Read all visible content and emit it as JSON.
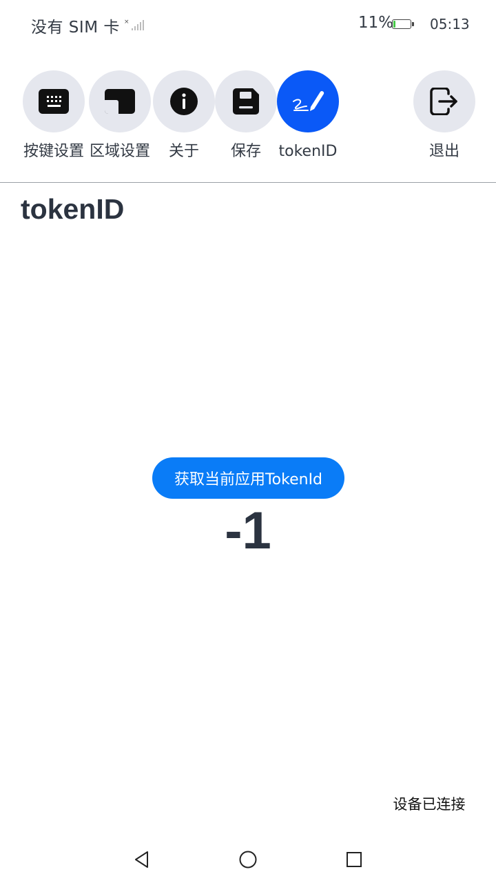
{
  "status_bar": {
    "carrier": "没有 SIM 卡",
    "battery_percent": "11%",
    "battery_level": 0.11,
    "battery_color": "#45c946",
    "time": "05:13",
    "signal_icon": "no-signal-icon"
  },
  "toolbar": {
    "items": [
      {
        "label": "按键设置",
        "icon": "keyboard-icon"
      },
      {
        "label": "区域设置",
        "icon": "region-icon"
      },
      {
        "label": "关于",
        "icon": "info-icon"
      },
      {
        "label": "保存",
        "icon": "save-icon"
      },
      {
        "label": "tokenID",
        "icon": "signature-pen-icon",
        "active": true
      },
      {
        "label": "退出",
        "icon": "exit-icon"
      }
    ],
    "active_color": "#0a59f7"
  },
  "main": {
    "title": "tokenID",
    "get_token_button": "获取当前应用TokenId",
    "token_value": "-1",
    "button_color": "#0a7cf7"
  },
  "footer": {
    "connection_status": "设备已连接"
  },
  "nav_bar": {
    "back_icon": "back-triangle-icon",
    "home_icon": "home-circle-icon",
    "recents_icon": "recents-square-icon"
  }
}
